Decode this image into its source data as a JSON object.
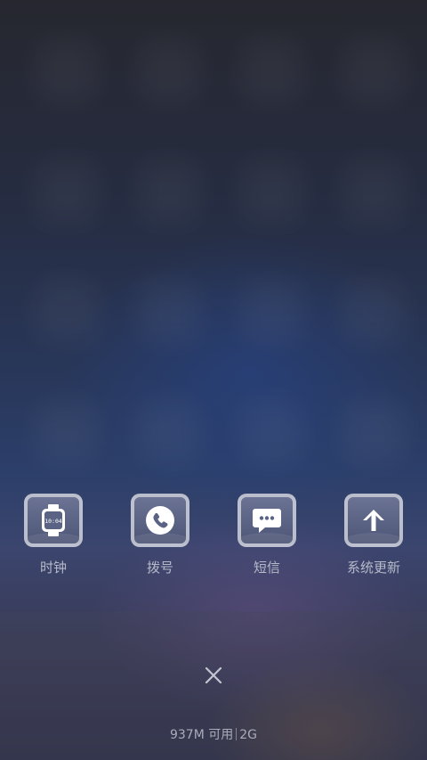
{
  "dock": {
    "apps": [
      {
        "label": "时钟",
        "icon": "watch-icon",
        "watch_time": "10:04"
      },
      {
        "label": "拨号",
        "icon": "phone-icon"
      },
      {
        "label": "短信",
        "icon": "message-icon"
      },
      {
        "label": "系统更新",
        "icon": "arrow-up-icon"
      }
    ]
  },
  "close": {
    "icon": "close-icon"
  },
  "memory": {
    "available": "937M 可用",
    "total": "2G"
  },
  "colors": {
    "icon_border": "#cdd0da",
    "label_text": "#b6bac8",
    "background_top": "#26272f",
    "background_mid": "#2c3f6a"
  }
}
